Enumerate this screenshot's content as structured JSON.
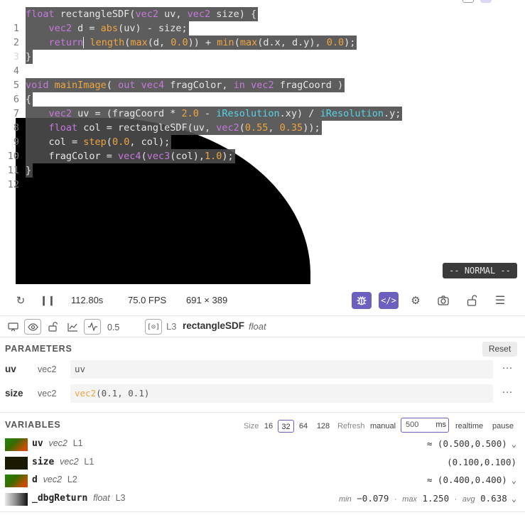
{
  "editor": {
    "line_numbers": [
      "1",
      "2",
      "3",
      "4",
      "5",
      "6",
      "7",
      "8",
      "9",
      "10",
      "11",
      "12"
    ],
    "mode_label": "-- NORMAL --"
  },
  "toolbar": {
    "time": "112.80s",
    "fps": "75.0 FPS",
    "resolution": "691 × 389"
  },
  "debug": {
    "value": "0.5",
    "line": "L3",
    "function_name": "rectangleSDF",
    "function_type": "float"
  },
  "parameters": {
    "title": "PARAMETERS",
    "reset_label": "Reset",
    "items": [
      {
        "name": "uv",
        "type": "vec2",
        "value_plain": "uv"
      },
      {
        "name": "size",
        "type": "vec2",
        "value_fn": "vec2",
        "value_args": "(0.1, 0.1)"
      }
    ],
    "more_label": "···"
  },
  "variables": {
    "title": "VARIABLES",
    "size_label": "Size",
    "sizes": [
      "16",
      "32",
      "64",
      "128"
    ],
    "selected_size": "32",
    "refresh_label": "Refresh",
    "manual_label": "manual",
    "refresh_ms": "500",
    "ms_unit": "ms",
    "realtime_label": "realtime",
    "pause_label": "pause",
    "items": [
      {
        "name": "uv",
        "type": "vec2",
        "loc": "L1",
        "value": "≈ (0.500,0.500)"
      },
      {
        "name": "size",
        "type": "vec2",
        "loc": "L1",
        "value": "(0.100,0.100)"
      },
      {
        "name": "d",
        "type": "vec2",
        "loc": "L2",
        "value": "≈ (0.400,0.400)"
      },
      {
        "name": "_dbgReturn",
        "type": "float",
        "loc": "L3",
        "min_label": "min",
        "min": "−0.079",
        "max_label": "max",
        "max": "1.250",
        "avg_label": "avg",
        "avg": "0.638"
      }
    ]
  },
  "colors": {
    "accent": "#6b5fbf",
    "keyword": "#c678dd",
    "function": "#f0a540",
    "builtin": "#56d4e6"
  }
}
